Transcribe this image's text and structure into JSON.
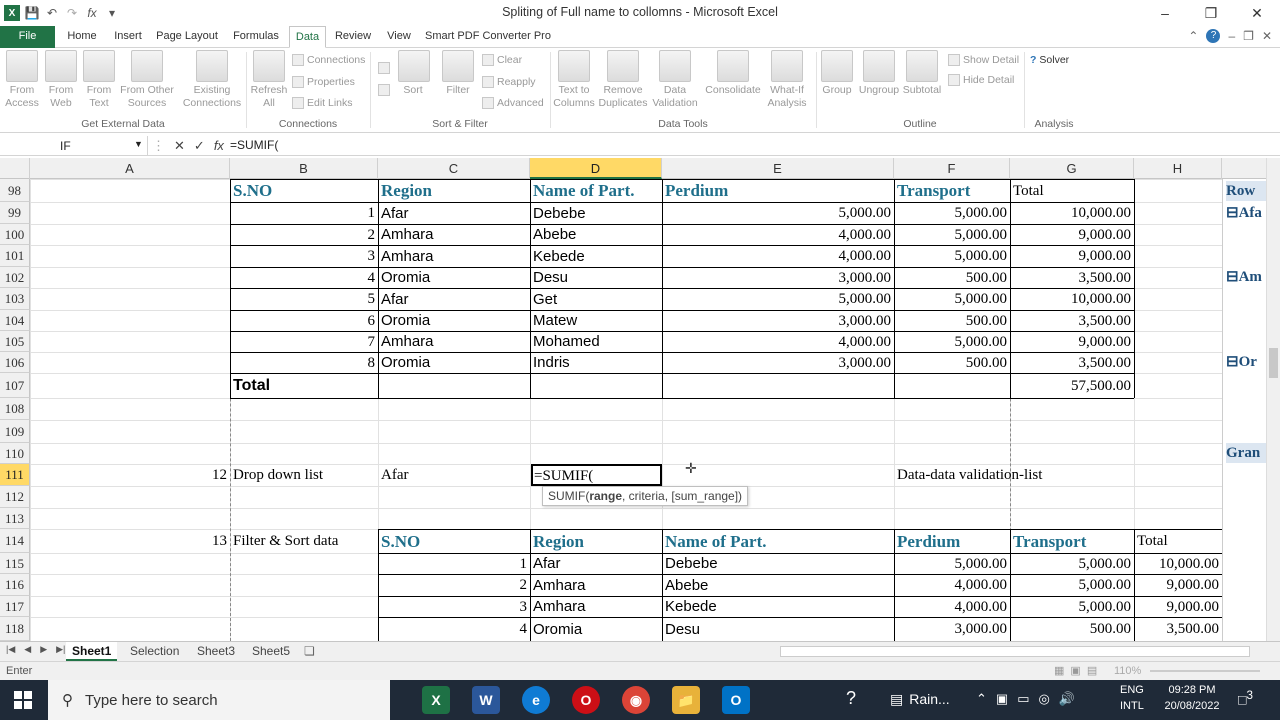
{
  "window": {
    "title": "Spliting of Full name to collomns - Microsoft Excel"
  },
  "tabs": [
    "File",
    "Home",
    "Insert",
    "Page Layout",
    "Formulas",
    "Data",
    "Review",
    "View",
    "Smart PDF Converter Pro"
  ],
  "ribbon": {
    "from_access": "From Access",
    "from_web": "From Web",
    "from_text": "From Text",
    "from_other": "From Other Sources",
    "existing": "Existing Connections",
    "refresh_all": "Refresh All",
    "connections": "Connections",
    "properties": "Properties",
    "edit_links": "Edit Links",
    "sort": "Sort",
    "filter": "Filter",
    "clear": "Clear",
    "reapply": "Reapply",
    "advanced": "Advanced",
    "text_to_columns": "Text to Columns",
    "remove_duplicates": "Remove Duplicates",
    "data_validation": "Data Validation",
    "consolidate": "Consolidate",
    "what_if": "What-If Analysis",
    "group": "Group",
    "ungroup": "Ungroup",
    "subtotal": "Subtotal",
    "show_detail": "Show Detail",
    "hide_detail": "Hide Detail",
    "solver": "Solver",
    "groups": {
      "external": "Get External Data",
      "connections": "Connections",
      "sortfilter": "Sort & Filter",
      "datatools": "Data Tools",
      "outline": "Outline",
      "analysis": "Analysis"
    }
  },
  "formula_bar": {
    "name_box": "IF",
    "formula": "=SUMIF("
  },
  "columns": [
    "A",
    "B",
    "C",
    "D",
    "E",
    "F",
    "G",
    "H"
  ],
  "rows": [
    "98",
    "99",
    "100",
    "101",
    "102",
    "103",
    "104",
    "105",
    "106",
    "107",
    "108",
    "109",
    "110",
    "111",
    "112",
    "113",
    "114",
    "115",
    "116",
    "117",
    "118"
  ],
  "table1": {
    "headers": [
      "S.NO",
      "Region",
      "Name of Part.",
      "Perdium",
      "Transport",
      "Total"
    ],
    "rows": [
      [
        "1",
        "Afar",
        "Debebe",
        "5,000.00",
        "5,000.00",
        "10,000.00"
      ],
      [
        "2",
        "Amhara",
        "Abebe",
        "4,000.00",
        "5,000.00",
        "9,000.00"
      ],
      [
        "3",
        "Amhara",
        "Kebede",
        "4,000.00",
        "5,000.00",
        "9,000.00"
      ],
      [
        "4",
        "Oromia",
        "Desu",
        "3,000.00",
        "500.00",
        "3,500.00"
      ],
      [
        "5",
        "Afar",
        "Get",
        "5,000.00",
        "5,000.00",
        "10,000.00"
      ],
      [
        "6",
        "Oromia",
        "Matew",
        "3,000.00",
        "500.00",
        "3,500.00"
      ],
      [
        "7",
        "Amhara",
        "Mohamed",
        "4,000.00",
        "5,000.00",
        "9,000.00"
      ],
      [
        "8",
        "Oromia",
        "Indris",
        "3,000.00",
        "500.00",
        "3,500.00"
      ]
    ],
    "total_label": "Total",
    "total_value": "57,500.00"
  },
  "row111": {
    "num": "12",
    "label": "Drop down list",
    "value": "Afar",
    "editing": "=SUMIF(",
    "note": "Data-data validation-list"
  },
  "tooltip": {
    "func": "SUMIF(",
    "bold": "range",
    "rest": ", criteria, [sum_range])"
  },
  "row114": {
    "num": "13",
    "label": "Filter & Sort data"
  },
  "table2": {
    "headers": [
      "S.NO",
      "Region",
      "Name of Part.",
      "Perdium",
      "Transport",
      "Total"
    ],
    "rows": [
      [
        "1",
        "Afar",
        "Debebe",
        "5,000.00",
        "5,000.00",
        "10,000.00"
      ],
      [
        "2",
        "Amhara",
        "Abebe",
        "4,000.00",
        "5,000.00",
        "9,000.00"
      ],
      [
        "3",
        "Amhara",
        "Kebede",
        "4,000.00",
        "5,000.00",
        "9,000.00"
      ],
      [
        "4",
        "Oromia",
        "Desu",
        "3,000.00",
        "500.00",
        "3,500.00"
      ]
    ]
  },
  "pivot": {
    "row": "Row",
    "afar": "Afa",
    "amhara": "Am",
    "oromia": "Or",
    "grand": "Gran"
  },
  "sheets": [
    "Sheet1",
    "Selection",
    "Sheet3",
    "Sheet5"
  ],
  "status": {
    "mode": "Enter",
    "zoom": "110%"
  },
  "taskbar": {
    "search": "Type here to search",
    "weather": "Rain...",
    "lang1": "ENG",
    "lang2": "INTL",
    "time": "09:28 PM",
    "date": "20/08/2022",
    "notif": "3"
  }
}
